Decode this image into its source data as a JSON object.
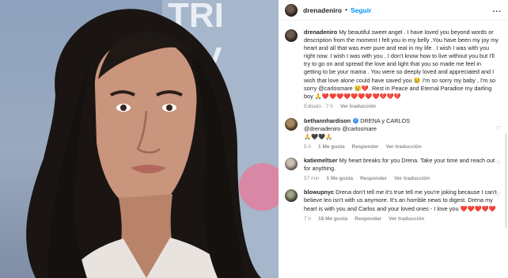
{
  "header": {
    "username": "drenadeniro",
    "follow_label": "Seguir",
    "separator": "•",
    "more": "..."
  },
  "caption": {
    "username": "drenadeniro",
    "text": "My beautiful sweet angel . I have loved you beyond words or description from the moment I felt you in my belly .You have been my joy my heart and all that was ever pure and real in my life . I wish I was with you right now. I wish I was with you . I don't know how to live without you but I'll try to go on and spread the love and light that you so made me feel in getting to be your mama . You were so deeply loved and appreciated and I wish that love alone could have saved you 😢 I'm so sorry my baby , I'm so sorry @carlosmare 😢💔. Rest in Peace and Eternal Paradise my darling boy 🙏❤️❤️❤️❤️❤️❤️❤️❤️💔💔💔",
    "edited": "Editado · 7 h",
    "translate": "Ver traducción"
  },
  "comments": [
    {
      "username": "bethannhardison",
      "verified_mark": "✓",
      "line1": "DRENA y CARLOS",
      "line2": "@drenadeniro @carlosmare",
      "line3": "🙏🖤🖤🙏",
      "time": "5 h",
      "likes": "1 Me gusta",
      "reply": "Responder",
      "translate": "Ver traducción"
    },
    {
      "username": "katiemeltser",
      "text": "My heart breaks for you Drena. Take your time and reach out for anything.",
      "time": "57 min",
      "likes": "1 Me gusta",
      "reply": "Responder",
      "translate": "Ver traducción"
    },
    {
      "username": "blowupnyc",
      "text": "Drena don't tell me it's true tell me you're joking because I can't believe leo isn't with us anymore. It's an horrible news to digest. Drena my heart is with you and Carlos and your loved ones - I love you ❤️❤️❤️❤️❤️",
      "time": "7 h",
      "likes": "18 Me gusta",
      "reply": "Responder",
      "translate": "Ver traducción"
    }
  ],
  "photo_sign_text": "TRI\nT V",
  "icons": {
    "heart": "heart-icon",
    "more": "more-options-icon"
  }
}
